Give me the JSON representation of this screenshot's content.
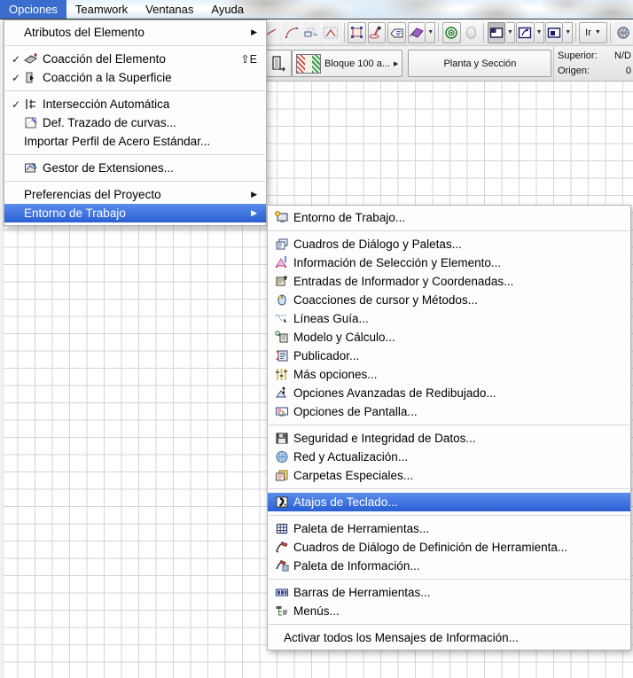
{
  "menubar": {
    "items": [
      {
        "label": "Opciones",
        "active": true
      },
      {
        "label": "Teamwork",
        "active": false
      },
      {
        "label": "Ventanas",
        "active": false
      },
      {
        "label": "Ayuda",
        "active": false
      }
    ]
  },
  "toolbar": {
    "go_button_label": "Ir",
    "element_panel_label": "Bloque 100 a...",
    "view_panel_label": "Planta y Sección",
    "status": {
      "top_label": "Superior:",
      "top_value": "N/D",
      "origin_label": "Origen:",
      "origin_value": "0"
    }
  },
  "menu_opciones": {
    "title": "Opciones",
    "items": [
      {
        "label": "Atributos del Elemento",
        "checked": false,
        "icon": null,
        "submenu": true,
        "shortcut": "",
        "selected": false
      },
      {
        "separator": true
      },
      {
        "label": "Coacción del Elemento",
        "checked": true,
        "icon": "element-constraint-icon",
        "submenu": false,
        "shortcut": "⇧E",
        "selected": false
      },
      {
        "label": "Coacción a la Superficie",
        "checked": true,
        "icon": "surface-constraint-icon",
        "submenu": false,
        "shortcut": "",
        "selected": false
      },
      {
        "separator": true
      },
      {
        "label": "Intersección Automática",
        "checked": true,
        "icon": "auto-intersection-icon",
        "submenu": false,
        "shortcut": "",
        "selected": false
      },
      {
        "label": "Def. Trazado de curvas...",
        "checked": false,
        "icon": "curve-trace-icon",
        "submenu": false,
        "shortcut": "",
        "selected": false
      },
      {
        "label": "Importar Perfil de Acero Estándar...",
        "checked": false,
        "icon": null,
        "submenu": false,
        "shortcut": "",
        "selected": false
      },
      {
        "separator": true
      },
      {
        "label": "Gestor de Extensiones...",
        "checked": false,
        "icon": "extension-manager-icon",
        "submenu": false,
        "shortcut": "",
        "selected": false
      },
      {
        "separator": true
      },
      {
        "label": "Preferencias del Proyecto",
        "checked": false,
        "icon": null,
        "submenu": true,
        "shortcut": "",
        "selected": false
      },
      {
        "label": "Entorno de Trabajo",
        "checked": false,
        "icon": null,
        "submenu": true,
        "shortcut": "",
        "selected": true
      }
    ]
  },
  "menu_entorno": {
    "title": "Entorno de Trabajo",
    "items": [
      {
        "label": "Entorno de Trabajo...",
        "icon": "workspace-icon",
        "selected": false
      },
      {
        "separator": true
      },
      {
        "label": "Cuadros de Diálogo y Paletas...",
        "icon": "dialogs-palettes-icon",
        "selected": false
      },
      {
        "label": "Información de Selección y Elemento...",
        "icon": "selection-info-icon",
        "selected": false
      },
      {
        "label": "Entradas de Informador y Coordenadas...",
        "icon": "tracker-coordinates-icon",
        "selected": false
      },
      {
        "label": "Coacciones de cursor y Métodos...",
        "icon": "mouse-constraints-icon",
        "selected": false
      },
      {
        "label": "Líneas Guía...",
        "icon": "guide-lines-icon",
        "selected": false
      },
      {
        "label": "Modelo y Cálculo...",
        "icon": "model-calculation-icon",
        "selected": false
      },
      {
        "label": "Publicador...",
        "icon": "publisher-icon",
        "selected": false
      },
      {
        "label": "Más opciones...",
        "icon": "more-options-icon",
        "selected": false
      },
      {
        "label": "Opciones Avanzadas de Redibujado...",
        "icon": "advanced-redraw-icon",
        "selected": false
      },
      {
        "label": "Opciones de Pantalla...",
        "icon": "screen-options-icon",
        "selected": false
      },
      {
        "separator": true
      },
      {
        "label": "Seguridad e Integridad de Datos...",
        "icon": "data-safety-icon",
        "selected": false
      },
      {
        "label": "Red y Actualización...",
        "icon": "network-update-icon",
        "selected": false
      },
      {
        "label": "Carpetas Especiales...",
        "icon": "special-folders-icon",
        "selected": false
      },
      {
        "separator": true
      },
      {
        "label": "Atajos de Teclado...",
        "icon": "keyboard-shortcuts-icon",
        "selected": true
      },
      {
        "separator": true
      },
      {
        "label": "Paleta de Herramientas...",
        "icon": "toolbox-palette-icon",
        "selected": false
      },
      {
        "label": "Cuadros de Diálogo de Definición de Herramienta...",
        "icon": "tool-settings-dialog-icon",
        "selected": false
      },
      {
        "label": "Paleta de Información...",
        "icon": "info-palette-icon",
        "selected": false
      },
      {
        "separator": true
      },
      {
        "label": "Barras de Herramientas...",
        "icon": "toolbars-icon",
        "selected": false
      },
      {
        "label": "Menús...",
        "icon": "menus-icon",
        "selected": false
      },
      {
        "separator": true
      },
      {
        "label": "Activar todos los Mensajes de Información...",
        "icon": null,
        "selected": false
      }
    ]
  },
  "colors": {
    "menu_highlight": "#2a5fd4",
    "menubar_highlight": "#3b6ecc",
    "menu_background": "#fdfdfd",
    "grid_line": "#d5d5d5"
  }
}
